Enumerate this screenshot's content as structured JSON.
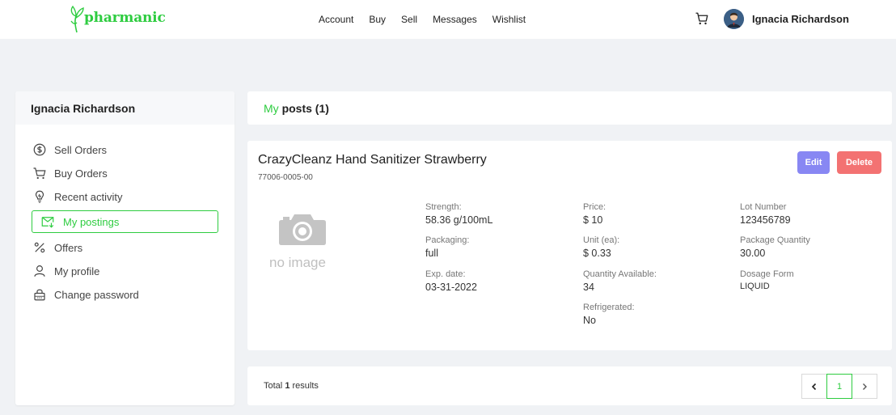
{
  "header": {
    "logo_text": "pharmanic",
    "nav": [
      "Account",
      "Buy",
      "Sell",
      "Messages",
      "Wishlist"
    ],
    "user_name": "Ignacia Richardson"
  },
  "sidebar": {
    "title": "Ignacia Richardson",
    "items": [
      {
        "label": "Sell Orders",
        "icon": "dollar-circle-icon"
      },
      {
        "label": "Buy Orders",
        "icon": "cart-icon"
      },
      {
        "label": "Recent activity",
        "icon": "bulb-icon"
      },
      {
        "label": "My postings",
        "icon": "mail-icon",
        "active": true
      },
      {
        "label": "Offers",
        "icon": "percent-icon"
      },
      {
        "label": "My profile",
        "icon": "user-icon"
      },
      {
        "label": "Change password",
        "icon": "lock-icon"
      }
    ]
  },
  "posts": {
    "prefix": "My",
    "title": "posts (1)"
  },
  "product": {
    "title": "CrazyCleanz Hand Sanitizer Strawberry",
    "code": "77006-0005-00",
    "edit_label": "Edit",
    "delete_label": "Delete",
    "no_image": "no image",
    "fields": {
      "strength": {
        "label": "Strength:",
        "value": "58.36 g/100mL"
      },
      "packaging": {
        "label": "Packaging:",
        "value": "full"
      },
      "exp_date": {
        "label": "Exp. date:",
        "value": "03-31-2022"
      },
      "price": {
        "label": "Price:",
        "value": "$ 10"
      },
      "unit": {
        "label": "Unit (ea):",
        "value": "$ 0.33"
      },
      "quantity": {
        "label": "Quantity Available:",
        "value": "34"
      },
      "refrigerated": {
        "label": "Refrigerated:",
        "value": "No"
      },
      "lot": {
        "label": "Lot Number",
        "value": "123456789"
      },
      "package_qty": {
        "label": "Package Quantity",
        "value": "30.00"
      },
      "dosage": {
        "label": "Dosage Form",
        "value": "LIQUID"
      }
    }
  },
  "footer": {
    "total_prefix": "Total",
    "total_count": "1",
    "total_suffix": "results",
    "current_page": "1"
  },
  "colors": {
    "accent": "#2ecc40",
    "edit": "#8887f3",
    "delete": "#f37272",
    "background": "#f0f2f5"
  }
}
